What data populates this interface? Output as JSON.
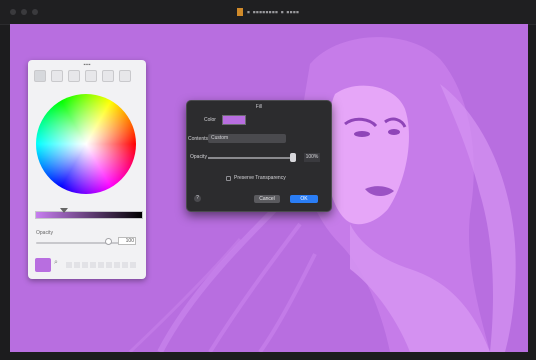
{
  "window": {
    "title": "▪ ▪▪▪▪▪▪▪▪ ▪ ▪▪▪▪",
    "traffic_lights": [
      "close",
      "minimize",
      "zoom"
    ]
  },
  "canvas": {
    "tint_color": "#b86ee0",
    "highlight_color": "#e6a6f8",
    "shadow_color": "#a55dcd"
  },
  "colors_panel": {
    "header": "▪▪▪▪",
    "mode_icons": [
      "color-wheel-icon",
      "sliders-icon",
      "palette-icon",
      "image-palette-icon",
      "crayons-icon",
      "pencils-icon"
    ],
    "selected_mode": "color-wheel-icon",
    "opacity_label": "Opacity",
    "opacity_value": "100",
    "current_color": "#b86ee0"
  },
  "dialog": {
    "title": "Fill",
    "color_label": "Color",
    "color_value": "#b86ee0",
    "contents_label": "Contents",
    "contents_value": "Custom",
    "opacity_label": "Opacity",
    "opacity_value": "100%",
    "opacity_fraction": 1.0,
    "preserve_transparency_label": "Preserve Transparency",
    "preserve_transparency_checked": false,
    "help_label": "?",
    "cancel_label": "Cancel",
    "ok_label": "OK",
    "accent_color": "#2a7df5"
  }
}
